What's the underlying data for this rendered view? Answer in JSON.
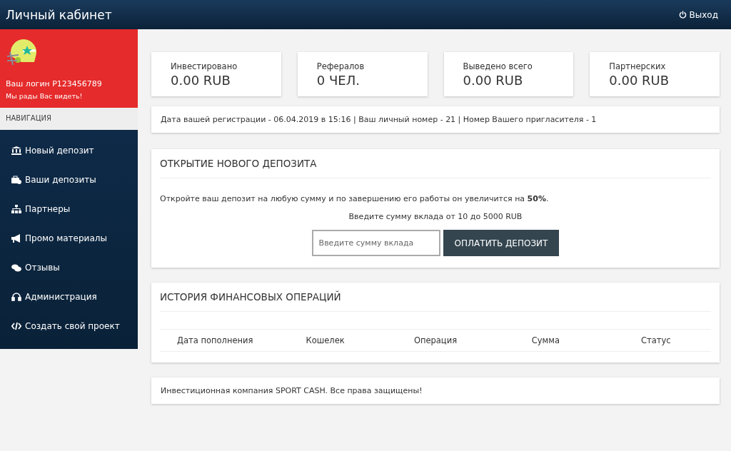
{
  "header": {
    "title": "Личный кабинет",
    "logout": "Выход"
  },
  "profile": {
    "login": "Ваш логин P123456789",
    "greeting": "Мы рады Вас видеть!"
  },
  "sidebar": {
    "heading": "НАВИГАЦИЯ",
    "items": [
      {
        "label": "Новый депозит"
      },
      {
        "label": "Ваши депозиты"
      },
      {
        "label": "Партнеры"
      },
      {
        "label": "Промо материалы"
      },
      {
        "label": "Отзывы"
      },
      {
        "label": "Администрация"
      },
      {
        "label": "Создать свой проект"
      }
    ]
  },
  "stats": [
    {
      "label": "Инвестировано",
      "value": "0.00 RUB"
    },
    {
      "label": "Рефералов",
      "value": "0 ЧЕЛ."
    },
    {
      "label": "Выведено всего",
      "value": "0.00 RUB"
    },
    {
      "label": "Партнерских",
      "value": "0.00 RUB"
    }
  ],
  "info": "Дата вашей регистрации - 06.04.2019 в 15:16 | Ваш личный номер - 21 | Номер Вашего пригласителя - 1",
  "deposit": {
    "title": "ОТКРЫТИЕ НОВОГО ДЕПОЗИТА",
    "text": "Откройте ваш депозит на любую сумму и по завершению его работы он увеличится на **50%**.",
    "hint": "Введите сумму вклада от 10 до 5000 RUB",
    "placeholder": "Введите сумму вклада",
    "button": "ОПЛАТИТЬ ДЕПОЗИТ"
  },
  "history": {
    "title": "ИСТОРИЯ ФИНАНСОВЫХ ОПЕРАЦИЙ",
    "columns": [
      "Дата пополнения",
      "Кошелек",
      "Операция",
      "Сумма",
      "Статус"
    ]
  },
  "footer": "Инвестиционная компания SPORT CASH. Все права защищены!"
}
